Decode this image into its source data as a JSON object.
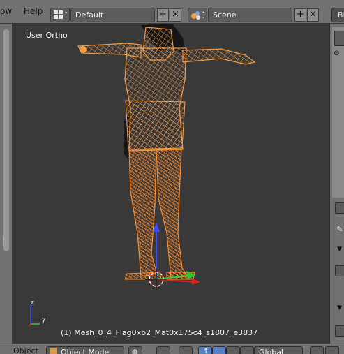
{
  "top_menu": {
    "item1": "ow",
    "item2": "Help"
  },
  "screen": {
    "value": "Default"
  },
  "scene": {
    "value": "Scene"
  },
  "right_header": {
    "label": "Bl"
  },
  "viewport": {
    "view_label": "User Ortho",
    "object_info": "(1) Mesh_0_4_Flag0xb2_Mat0x175c4_s1807_e3837",
    "axis_z": "z",
    "axis_y": "y"
  },
  "bottom": {
    "object_menu": "Object",
    "mode": "Object Mode",
    "orientation": "Global"
  },
  "colors": {
    "accent": "#5680c2",
    "wire_selected": "#f49a45",
    "wire_active": "#ff8a2a"
  },
  "icons": [
    "grid-layout-icon",
    "scene-icon",
    "plus-icon",
    "close-icon",
    "cube-icon",
    "sphere-icon",
    "manipulator-icon"
  ]
}
